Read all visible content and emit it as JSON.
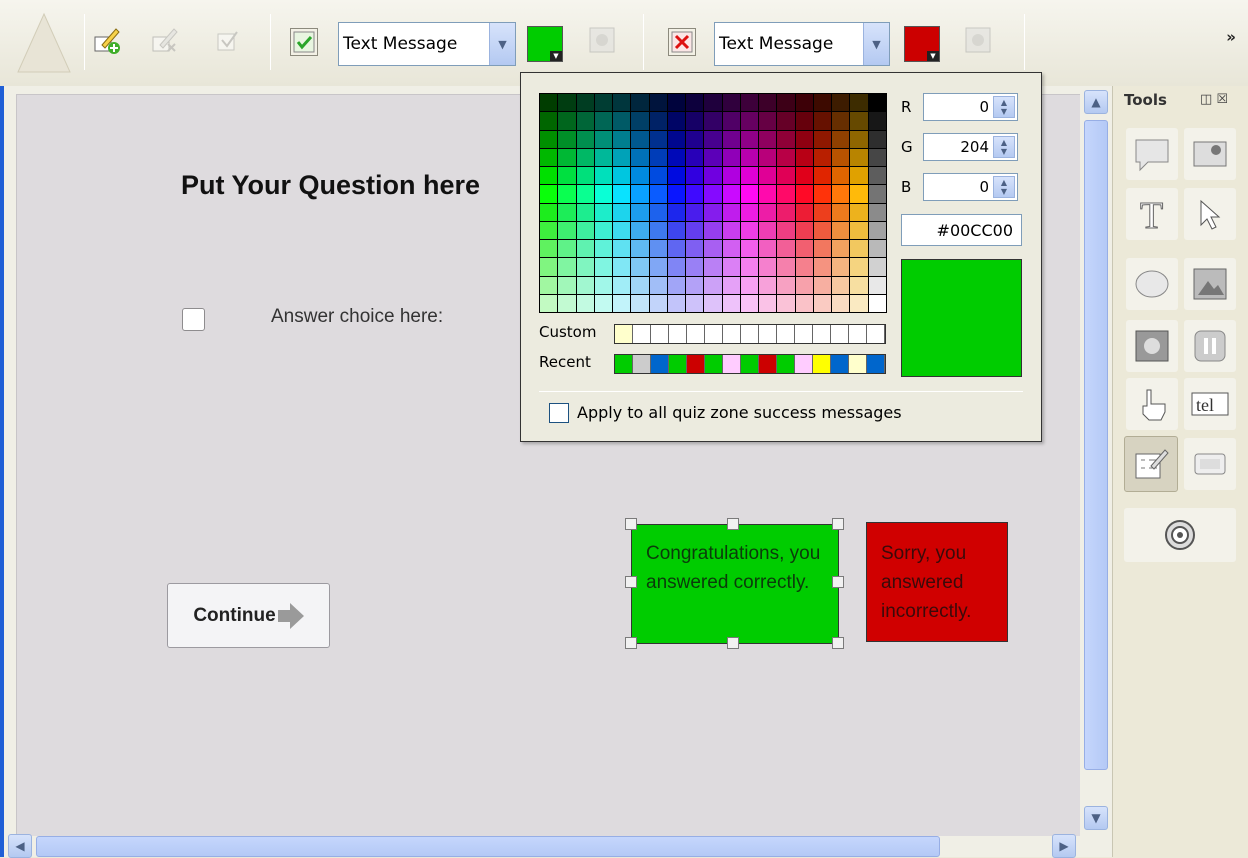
{
  "toolbar": {
    "success": {
      "message_type": "Text Message",
      "color": "#00CC00",
      "icon": "check-icon"
    },
    "failure": {
      "message_type": "Text Message",
      "color": "#CC0000",
      "icon": "x-icon"
    },
    "overflow": "»"
  },
  "stage": {
    "question": "Put Your Question here",
    "answer": "Answer choice here:",
    "continue_label": "Continue",
    "success_message": "Congratulations, you answered correctly.",
    "failure_message": "Sorry, you answered incorrectly."
  },
  "tools": {
    "title": "Tools",
    "items": [
      "speech-bubble-icon",
      "image-icon",
      "text-icon",
      "pointer-icon",
      "shape-icon",
      "picture-frame-icon",
      "puzzle-icon",
      "pause-icon",
      "hand-cursor-icon",
      "tel-icon",
      "quiz-icon",
      "button-icon",
      "audio-spiral-icon"
    ]
  },
  "color_picker": {
    "r_label": "R",
    "g_label": "G",
    "b_label": "B",
    "r": "0",
    "g": "204",
    "b": "0",
    "hex": "#00CC00",
    "custom_label": "Custom",
    "recent_label": "Recent",
    "recent_colors": [
      "#00cc00",
      "#cccccc",
      "#0066cc",
      "#00cc00",
      "#cc0000",
      "#00cc00",
      "#ffccff",
      "#00cc00",
      "#cc0000",
      "#00cc00",
      "#ffccff",
      "#ffff00",
      "#0066cc",
      "#ffffcc",
      "#0066cc"
    ],
    "custom_colors": [
      "#ffffcc",
      "#ffffff",
      "#ffffff",
      "#ffffff",
      "#ffffff",
      "#ffffff",
      "#ffffff",
      "#ffffff",
      "#ffffff",
      "#ffffff",
      "#ffffff",
      "#ffffff",
      "#ffffff",
      "#ffffff",
      "#ffffff"
    ],
    "apply_label": "Apply to all quiz zone success messages"
  }
}
